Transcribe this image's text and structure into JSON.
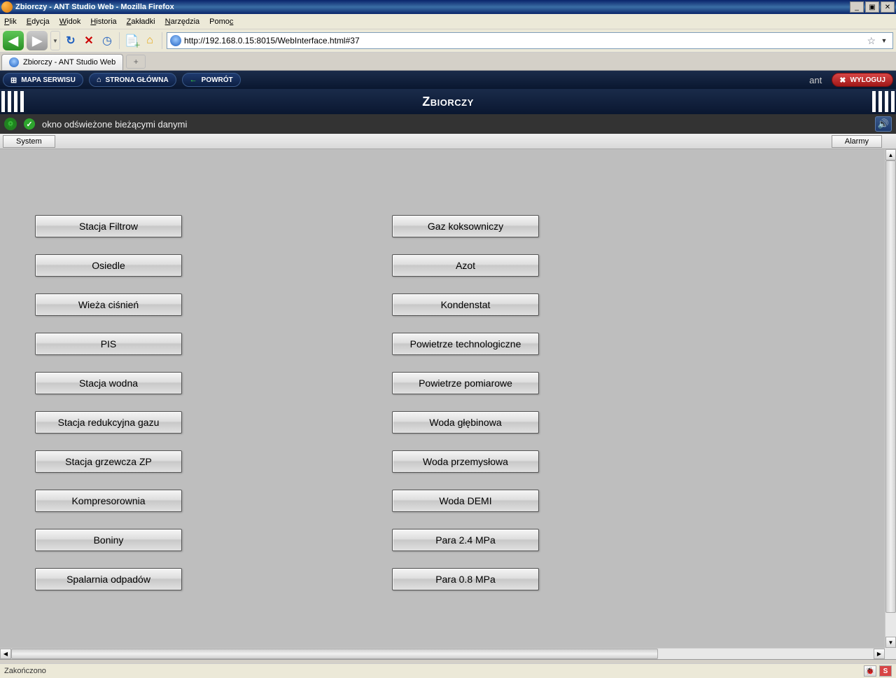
{
  "window": {
    "title": "Zbiorczy - ANT Studio Web - Mozilla Firefox"
  },
  "menu": {
    "file": "Plik",
    "edit": "Edycja",
    "view": "Widok",
    "history": "Historia",
    "bookmarks": "Zakładki",
    "tools": "Narzędzia",
    "help": "Pomoc"
  },
  "url": "http://192.168.0.15:8015/WebInterface.html#37",
  "tab": {
    "title": "Zbiorczy - ANT Studio Web"
  },
  "appnav": {
    "map": "MAPA SERWISU",
    "home": "STRONA GŁÓWNA",
    "back": "POWRÓT",
    "user": "ant",
    "logout": "WYLOGUJ"
  },
  "page": {
    "title": "Zbiorczy",
    "status_msg": "okno odświeżone bieżącymi danymi"
  },
  "subtabs": {
    "left": "System",
    "right": "Alarmy"
  },
  "columns": {
    "left": [
      "Stacja Filtrow",
      "Osiedle",
      "Wieża ciśnień",
      "PIS",
      "Stacja wodna",
      "Stacja redukcyjna gazu",
      "Stacja grzewcza ZP",
      "Kompresorownia",
      "Boniny",
      "Spalarnia odpadów"
    ],
    "right": [
      "Gaz koksowniczy",
      "Azot",
      "Kondenstat",
      "Powietrze technologiczne",
      "Powietrze pomiarowe",
      "Woda głębinowa",
      "Woda przemysłowa",
      "Woda DEMI",
      "Para 2.4 MPa",
      "Para 0.8 MPa"
    ]
  },
  "browser_status": "Zakończono"
}
